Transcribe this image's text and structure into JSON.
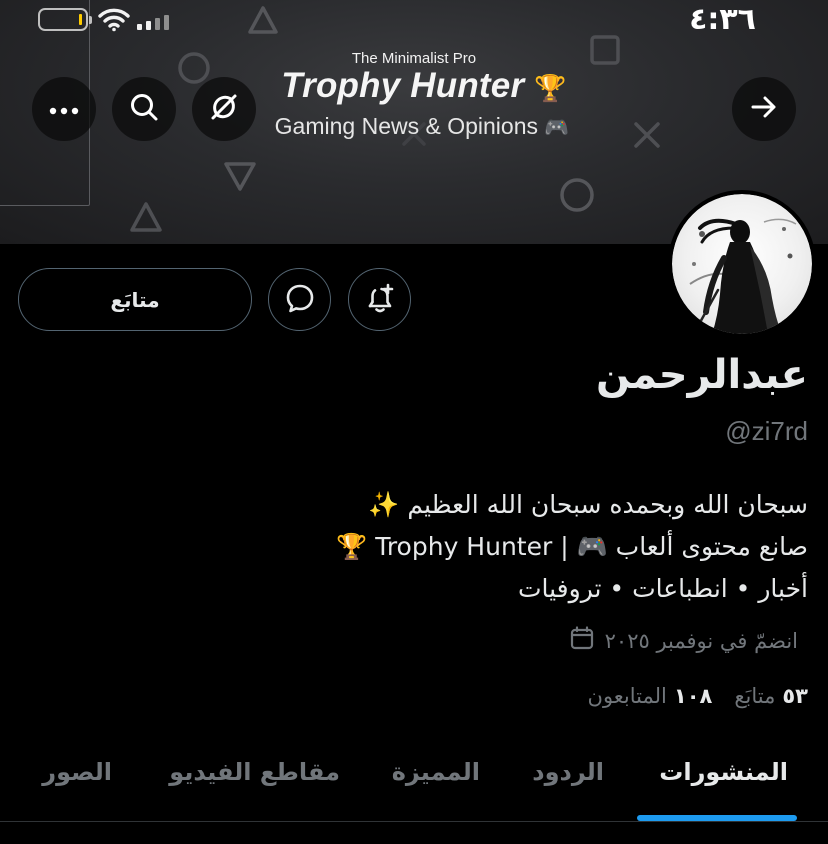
{
  "status_bar": {
    "time": "٤:٣٦"
  },
  "banner": {
    "subtitle": "The Minimalist Pro",
    "title": "Trophy Hunter",
    "title_emoji": "🏆",
    "tagline": "Gaming News & Opinions",
    "tagline_emoji": "🎮"
  },
  "nav": {
    "more_icon": "more-horizontal-icon",
    "search_icon": "search-icon",
    "grok_icon": "grok-icon",
    "forward_icon": "arrow-right-icon"
  },
  "actions": {
    "follow_label": "متابَع",
    "message_icon": "message-bubble-icon",
    "notify_icon": "bell-plus-icon"
  },
  "profile": {
    "display_name": "عبدالرحمن",
    "handle": "@zi7rd",
    "bio_lines": [
      "سبحان الله وبحمده سبحان الله العظيم ✨",
      "صانع محتوى ألعاب 🎮 | Trophy Hunter 🏆",
      "أخبار • انطباعات • تروفيات"
    ],
    "joined": "انضمّ في نوفمبر ٢٠٢٥",
    "following_count": "٥٣",
    "following_label": "متابَع",
    "followers_count": "١٠٨",
    "followers_label": "المتابعون"
  },
  "tabs": [
    {
      "label": "المنشورات",
      "active": true
    },
    {
      "label": "الردود",
      "active": false
    },
    {
      "label": "المميزة",
      "active": false
    },
    {
      "label": "مقاطع الفيديو",
      "active": false
    },
    {
      "label": "الصور",
      "active": false
    }
  ],
  "colors": {
    "accent": "#1d9bf0",
    "background": "#000000",
    "secondary_text": "#71767b",
    "border": "#536471"
  }
}
